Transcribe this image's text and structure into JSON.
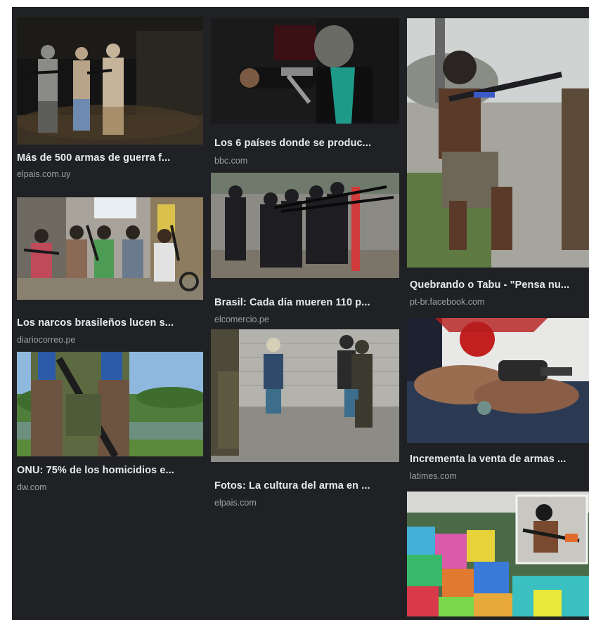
{
  "results": [
    {
      "title": "Más de 500 armas de guerra f...",
      "source": "elpais.com.uy",
      "image": "night-street-armed-men"
    },
    {
      "title": "Los narcos brasileños lucen s...",
      "source": "diariocorreo.pe",
      "image": "favela-armed-group"
    },
    {
      "title": "ONU: 75% de los homicidios e...",
      "source": "dw.com",
      "image": "soldier-with-rifle-lake"
    },
    {
      "title": "Los 6 países donde se produc...",
      "source": "bbc.com",
      "image": "masked-man-pistol"
    },
    {
      "title": "Brasil: Cada día mueren 110 p...",
      "source": "elcomercio.pe",
      "image": "police-aiming-rifles"
    },
    {
      "title": "Fotos: La cultura del arma en ...",
      "source": "elpais.com",
      "image": "police-search-wall"
    },
    {
      "title": "Quebrando o Tabu - \"Pensa nu...",
      "source": "pt-br.facebook.com",
      "image": "boy-aiming-rifle"
    },
    {
      "title": "Incrementa la venta de armas ...",
      "source": "latimes.com",
      "image": "revolver-in-hands"
    },
    {
      "title": "",
      "source": "",
      "image": "colorful-favela-armed-man"
    }
  ]
}
